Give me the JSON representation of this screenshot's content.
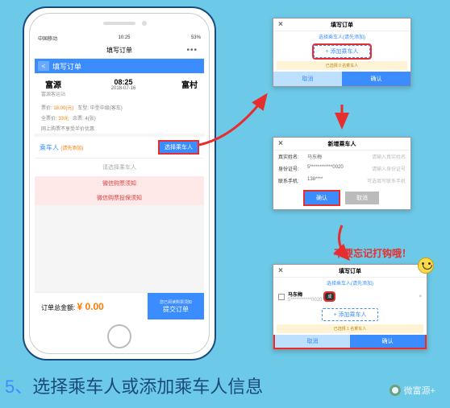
{
  "status_bar": {
    "carrier": "中国移动",
    "time": "10:25",
    "battery": "53%"
  },
  "app": {
    "title": "填写订单",
    "more": "•••"
  },
  "page_header": {
    "title": "填写订单",
    "back": "<"
  },
  "route": {
    "from": {
      "station": "富源",
      "sub": "富源客运站"
    },
    "to": {
      "station": "富村",
      "sub": ""
    },
    "time": "08:25",
    "date": "2018-07-16"
  },
  "trip_info": {
    "line1_label": "票价:",
    "line1_value": "18.00(元)",
    "line1_extra": "车型: 中型中级(客车)",
    "line2_label": "全票价:",
    "line2_value": "33元",
    "line2_extra": "余票: 4(张)",
    "line3": "网上购票不享受半价优惠"
  },
  "passenger": {
    "label": "乘车人",
    "hint": "(请先添加)",
    "select_btn": "选择乘车人",
    "empty_hint": "请选择乘车人"
  },
  "notices": {
    "n1": "微信购票须知",
    "n2": "微信购票投保须知"
  },
  "footer": {
    "total_label": "订单总金额:",
    "price": "¥ 0.00",
    "submit_tip": "您已阅读购票须知",
    "submit": "提交订单"
  },
  "popup1": {
    "title": "填写订单",
    "subtitle": "选择乘车人(请先添加)",
    "add_btn": "+ 添加乘车人",
    "warn": "已选择 0 名乘车人",
    "cancel": "取消",
    "confirm": "确认"
  },
  "popup2": {
    "title": "新增乘车人",
    "rows": [
      {
        "label": "真实姓名:",
        "value": "马东梅",
        "ph": "请输入真实姓名"
      },
      {
        "label": "身份证号:",
        "value": "5************0020",
        "ph": "请输入身份证号"
      },
      {
        "label": "联系手机:",
        "value": "138****",
        "ph": "可选填写联系手机"
      }
    ],
    "ok": "确认",
    "cancel": "取消"
  },
  "popup3": {
    "title": "填写订单",
    "subtitle": "选择乘车人(请先添加)",
    "passenger": {
      "name": "马东梅",
      "id": "5***********0020",
      "badge": "成",
      "del": "×"
    },
    "add_btn": "+ 添加乘车人",
    "warn": "已选择 1 名乘车人",
    "cancel": "取消",
    "confirm": "确认"
  },
  "reminder": "不要忘记打钩哦！",
  "step": {
    "num": "5、",
    "text": "选择乘车人或添加乘车人信息"
  },
  "watermark": "微富源+"
}
